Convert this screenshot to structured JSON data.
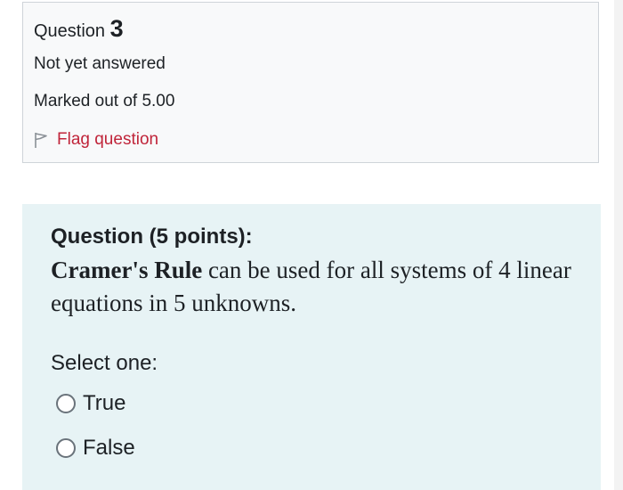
{
  "info": {
    "question_label": "Question",
    "question_number": "3",
    "state": "Not yet answered",
    "grade": "Marked out of 5.00",
    "flag_label": "Flag question"
  },
  "question": {
    "heading": "Question (5 points):",
    "text_bold": "Cramer's Rule",
    "text_rest": " can be used for all systems of 4 linear equations in 5 unknowns.",
    "prompt": "Select one:",
    "options": [
      {
        "label": "True",
        "selected": false
      },
      {
        "label": "False",
        "selected": false
      }
    ]
  },
  "colors": {
    "flag_link": "#c0253a",
    "content_bg": "#e7f3f5",
    "info_bg": "#f8f9fa"
  },
  "icons": {
    "flag": "flag-outline-icon",
    "radio": "radio-unchecked-icon"
  }
}
